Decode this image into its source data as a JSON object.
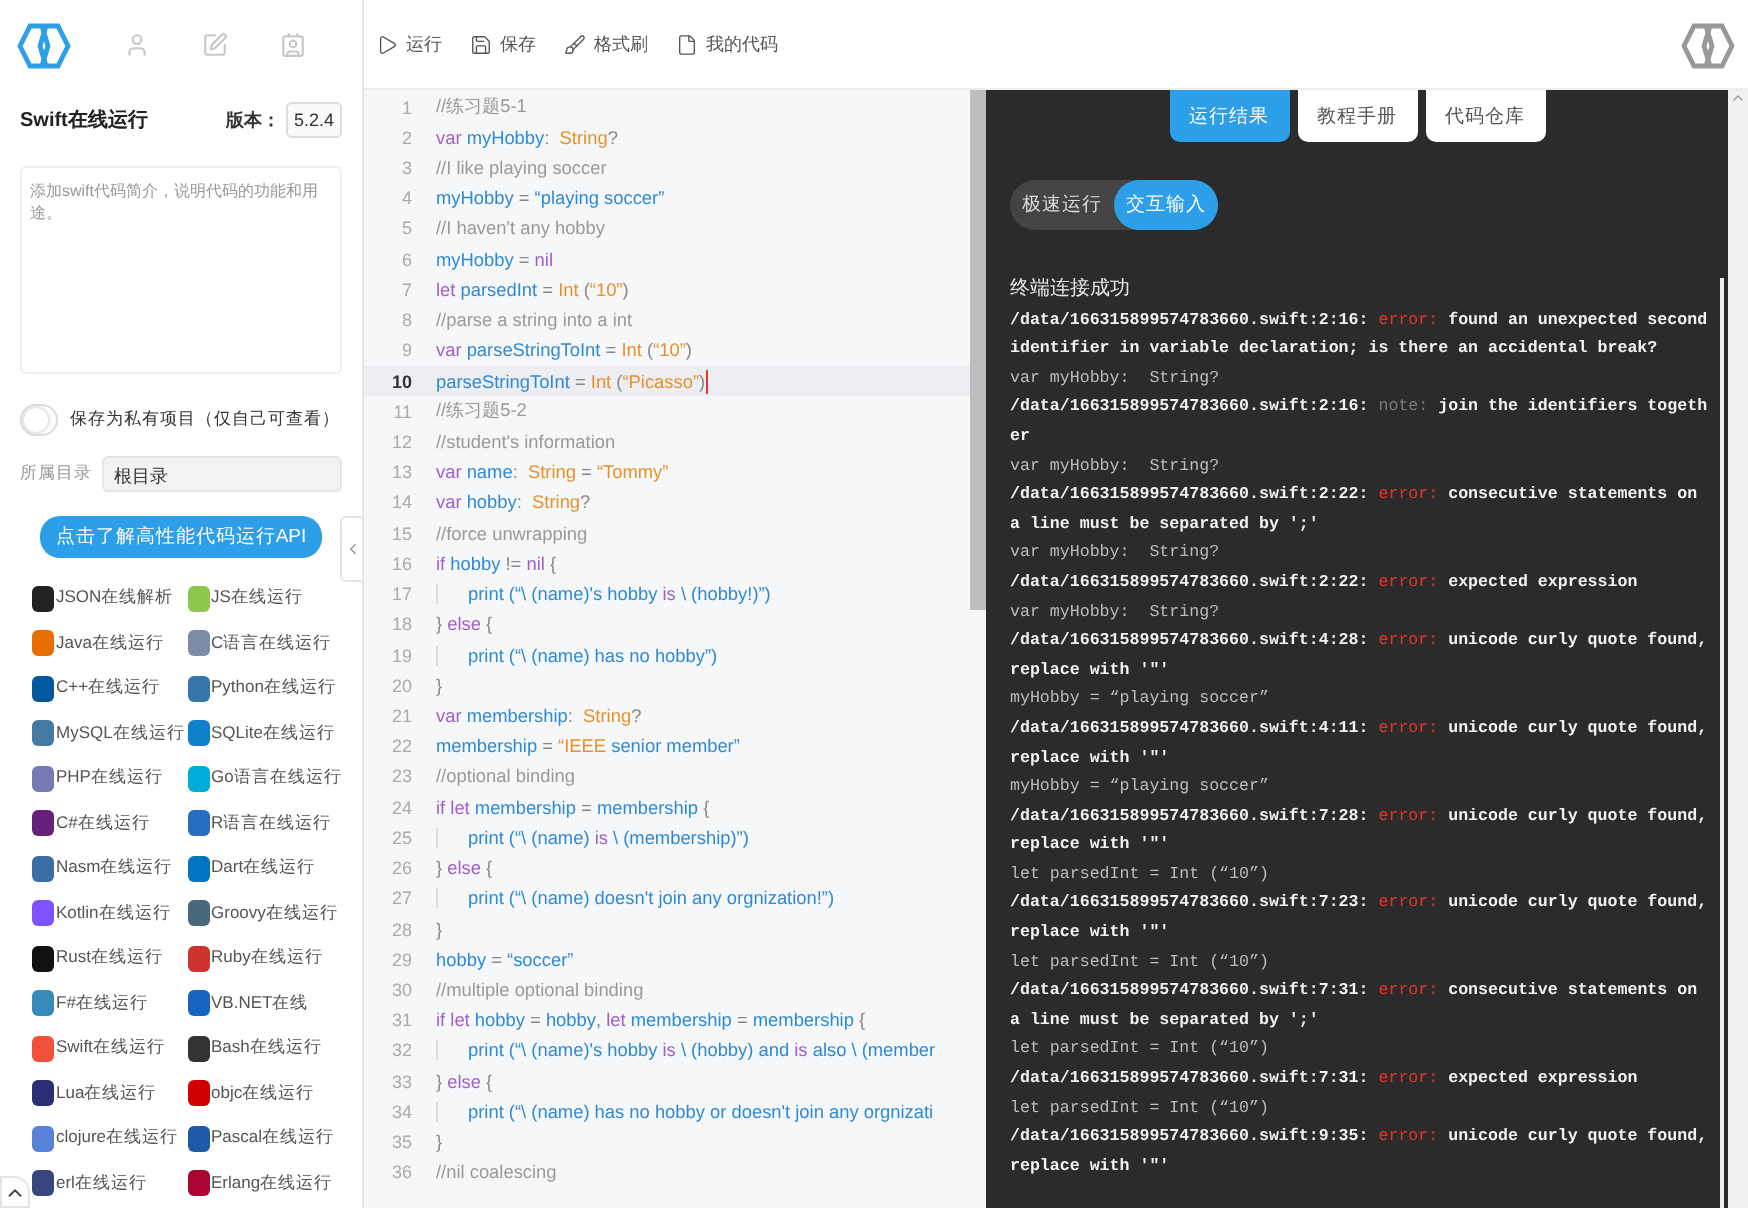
{
  "toolbar": {
    "buttons": [
      {
        "label": "运行",
        "kind": "run"
      },
      {
        "label": "保存",
        "kind": "save"
      },
      {
        "label": "格式刷",
        "kind": "format"
      },
      {
        "label": "我的代码",
        "kind": "file"
      }
    ]
  },
  "sidebar": {
    "title": "Swift在线运行",
    "version_label": "版本：",
    "version": "5.2.4",
    "description": {
      "placeholder": "添加swift代码简介，说明代码的功能和用途。"
    },
    "private_toggle": {
      "label": "保存为私有项目（仅自己可查看）",
      "on": false
    },
    "directory": {
      "label": "所属目录",
      "value": "根目录"
    },
    "api_button": "点击了解高性能代码运行API",
    "languages": [
      {
        "name": "JSON在线解析",
        "color": "#222222"
      },
      {
        "name": "JS在线运行",
        "color": "#8cc84b"
      },
      {
        "name": "Java在线运行",
        "color": "#e76f00"
      },
      {
        "name": "C语言在线运行",
        "color": "#7a8ca6"
      },
      {
        "name": "C++在线运行",
        "color": "#00599c"
      },
      {
        "name": "Python在线运行",
        "color": "#3776ab"
      },
      {
        "name": "MySQL在线运行",
        "color": "#4479a1"
      },
      {
        "name": "SQLite在线运行",
        "color": "#0f80cc"
      },
      {
        "name": "PHP在线运行",
        "color": "#777bb3"
      },
      {
        "name": "Go语言在线运行",
        "color": "#00add8"
      },
      {
        "name": "C#在线运行",
        "color": "#68217a"
      },
      {
        "name": "R语言在线运行",
        "color": "#276dc3"
      },
      {
        "name": "Nasm在线运行",
        "color": "#3a6ea5"
      },
      {
        "name": "Dart在线运行",
        "color": "#0175c2"
      },
      {
        "name": "Kotlin在线运行",
        "color": "#7f52ff"
      },
      {
        "name": "Groovy在线运行",
        "color": "#4a687c"
      },
      {
        "name": "Rust在线运行",
        "color": "#111111"
      },
      {
        "name": "Ruby在线运行",
        "color": "#cc342d"
      },
      {
        "name": "F#在线运行",
        "color": "#378bba"
      },
      {
        "name": "VB.NET在线",
        "color": "#1565c0"
      },
      {
        "name": "Swift在线运行",
        "color": "#f05138"
      },
      {
        "name": "Bash在线运行",
        "color": "#333333"
      },
      {
        "name": "Lua在线运行",
        "color": "#2c2d72"
      },
      {
        "name": "objc在线运行",
        "color": "#d00000"
      },
      {
        "name": "clojure在线运行",
        "color": "#5881d8"
      },
      {
        "name": "Pascal在线运行",
        "color": "#1e5aa8"
      },
      {
        "name": "erl在线运行",
        "color": "#39457e"
      },
      {
        "name": "Erlang在线运行",
        "color": "#a90533"
      }
    ]
  },
  "editor": {
    "lines": [
      {
        "n": "1",
        "active": false,
        "indent": false,
        "tokens": [
          {
            "kind": "comment",
            "text": "//练习题5-1"
          }
        ]
      },
      {
        "n": "2",
        "active": false,
        "indent": false,
        "tokens": [
          {
            "kind": "keyword",
            "text": "var"
          },
          {
            "kind": "ident",
            "text": " myHobby"
          },
          {
            "kind": "punct",
            "text": ":  "
          },
          {
            "kind": "type",
            "text": "String"
          },
          {
            "kind": "punct",
            "text": "?"
          }
        ]
      },
      {
        "n": "3",
        "active": false,
        "indent": false,
        "tokens": [
          {
            "kind": "comment",
            "text": "//I like playing soccer"
          }
        ]
      },
      {
        "n": "4",
        "active": false,
        "indent": false,
        "tokens": [
          {
            "kind": "ident",
            "text": "myHobby"
          },
          {
            "kind": "punct",
            "text": " = "
          },
          {
            "kind": "ident",
            "text": "“playing soccer”"
          }
        ]
      },
      {
        "n": "5",
        "active": false,
        "indent": false,
        "tokens": [
          {
            "kind": "comment",
            "text": "//I haven't any hobby"
          }
        ]
      },
      {
        "n": "6",
        "active": false,
        "indent": false,
        "tokens": [
          {
            "kind": "ident",
            "text": "myHobby"
          },
          {
            "kind": "punct",
            "text": " = "
          },
          {
            "kind": "keyword",
            "text": "nil"
          }
        ]
      },
      {
        "n": "7",
        "active": false,
        "indent": false,
        "tokens": [
          {
            "kind": "keyword",
            "text": "let"
          },
          {
            "kind": "ident",
            "text": " parsedInt"
          },
          {
            "kind": "punct",
            "text": " = "
          },
          {
            "kind": "type",
            "text": "Int"
          },
          {
            "kind": "punct",
            "text": " ("
          },
          {
            "kind": "type",
            "text": "“10”"
          },
          {
            "kind": "punct",
            "text": ")"
          }
        ]
      },
      {
        "n": "8",
        "active": false,
        "indent": false,
        "tokens": [
          {
            "kind": "comment",
            "text": "//parse a string into a int"
          }
        ]
      },
      {
        "n": "9",
        "active": false,
        "indent": false,
        "tokens": [
          {
            "kind": "keyword",
            "text": "var"
          },
          {
            "kind": "ident",
            "text": " parseStringToInt"
          },
          {
            "kind": "punct",
            "text": " = "
          },
          {
            "kind": "type",
            "text": "Int"
          },
          {
            "kind": "punct",
            "text": " ("
          },
          {
            "kind": "type",
            "text": "“10”"
          },
          {
            "kind": "punct",
            "text": ")"
          }
        ]
      },
      {
        "n": "10",
        "active": true,
        "indent": false,
        "tokens": [
          {
            "kind": "ident",
            "text": "parseStringToInt"
          },
          {
            "kind": "punct",
            "text": " = "
          },
          {
            "kind": "type",
            "text": "Int"
          },
          {
            "kind": "punct",
            "text": " ("
          },
          {
            "kind": "type",
            "text": "“Picasso”"
          },
          {
            "kind": "punct",
            "text": ")"
          }
        ]
      },
      {
        "n": "11",
        "active": false,
        "indent": false,
        "tokens": [
          {
            "kind": "comment",
            "text": "//练习题5-2"
          }
        ]
      },
      {
        "n": "12",
        "active": false,
        "indent": false,
        "tokens": [
          {
            "kind": "comment",
            "text": "//student's information"
          }
        ]
      },
      {
        "n": "13",
        "active": false,
        "indent": false,
        "tokens": [
          {
            "kind": "keyword",
            "text": "var"
          },
          {
            "kind": "ident",
            "text": " name"
          },
          {
            "kind": "punct",
            "text": ":  "
          },
          {
            "kind": "type",
            "text": "String"
          },
          {
            "kind": "punct",
            "text": " = "
          },
          {
            "kind": "type",
            "text": "“Tommy”"
          }
        ]
      },
      {
        "n": "14",
        "active": false,
        "indent": false,
        "tokens": [
          {
            "kind": "keyword",
            "text": "var"
          },
          {
            "kind": "ident",
            "text": " hobby"
          },
          {
            "kind": "punct",
            "text": ":  "
          },
          {
            "kind": "type",
            "text": "String"
          },
          {
            "kind": "punct",
            "text": "?"
          }
        ]
      },
      {
        "n": "15",
        "active": false,
        "indent": false,
        "tokens": [
          {
            "kind": "comment",
            "text": "//force unwrapping"
          }
        ]
      },
      {
        "n": "16",
        "active": false,
        "indent": false,
        "tokens": [
          {
            "kind": "keyword",
            "text": "if"
          },
          {
            "kind": "ident",
            "text": " hobby"
          },
          {
            "kind": "punct",
            "text": " != "
          },
          {
            "kind": "keyword",
            "text": "nil"
          },
          {
            "kind": "punct",
            "text": " {"
          }
        ]
      },
      {
        "n": "17",
        "active": false,
        "indent": true,
        "tokens": [
          {
            "kind": "ident",
            "text": "print (“\\ (name)'s hobby "
          },
          {
            "kind": "keyword",
            "text": "is"
          },
          {
            "kind": "ident",
            "text": " \\ (hobby!)”)"
          }
        ]
      },
      {
        "n": "18",
        "active": false,
        "indent": false,
        "tokens": [
          {
            "kind": "punct",
            "text": "} "
          },
          {
            "kind": "keyword",
            "text": "else"
          },
          {
            "kind": "punct",
            "text": " {"
          }
        ]
      },
      {
        "n": "19",
        "active": false,
        "indent": true,
        "tokens": [
          {
            "kind": "ident",
            "text": "print (“\\ (name) has no hobby”)"
          }
        ]
      },
      {
        "n": "20",
        "active": false,
        "indent": false,
        "tokens": [
          {
            "kind": "punct",
            "text": "}"
          }
        ]
      },
      {
        "n": "21",
        "active": false,
        "indent": false,
        "tokens": [
          {
            "kind": "keyword",
            "text": "var"
          },
          {
            "kind": "ident",
            "text": " membership"
          },
          {
            "kind": "punct",
            "text": ":  "
          },
          {
            "kind": "type",
            "text": "String"
          },
          {
            "kind": "punct",
            "text": "?"
          }
        ]
      },
      {
        "n": "22",
        "active": false,
        "indent": false,
        "tokens": [
          {
            "kind": "ident",
            "text": "membership"
          },
          {
            "kind": "punct",
            "text": " = "
          },
          {
            "kind": "type",
            "text": "“IEEE"
          },
          {
            "kind": "ident",
            "text": " senior member”"
          }
        ]
      },
      {
        "n": "23",
        "active": false,
        "indent": false,
        "tokens": [
          {
            "kind": "comment",
            "text": "//optional binding"
          }
        ]
      },
      {
        "n": "24",
        "active": false,
        "indent": false,
        "tokens": [
          {
            "kind": "keyword",
            "text": "if let"
          },
          {
            "kind": "ident",
            "text": " membership"
          },
          {
            "kind": "punct",
            "text": " = "
          },
          {
            "kind": "ident",
            "text": "membership"
          },
          {
            "kind": "punct",
            "text": " {"
          }
        ]
      },
      {
        "n": "25",
        "active": false,
        "indent": true,
        "tokens": [
          {
            "kind": "ident",
            "text": "print (“\\ (name) "
          },
          {
            "kind": "keyword",
            "text": "is"
          },
          {
            "kind": "ident",
            "text": " \\ (membership)”)"
          }
        ]
      },
      {
        "n": "26",
        "active": false,
        "indent": false,
        "tokens": [
          {
            "kind": "punct",
            "text": "} "
          },
          {
            "kind": "keyword",
            "text": "else"
          },
          {
            "kind": "punct",
            "text": " {"
          }
        ]
      },
      {
        "n": "27",
        "active": false,
        "indent": true,
        "tokens": [
          {
            "kind": "ident",
            "text": "print (“\\ (name) doesn't join any orgnization!”)"
          }
        ]
      },
      {
        "n": "28",
        "active": false,
        "indent": false,
        "tokens": [
          {
            "kind": "punct",
            "text": "}"
          }
        ]
      },
      {
        "n": "29",
        "active": false,
        "indent": false,
        "tokens": [
          {
            "kind": "ident",
            "text": "hobby"
          },
          {
            "kind": "punct",
            "text": " = "
          },
          {
            "kind": "ident",
            "text": "“soccer”"
          }
        ]
      },
      {
        "n": "30",
        "active": false,
        "indent": false,
        "tokens": [
          {
            "kind": "comment",
            "text": "//multiple optional binding"
          }
        ]
      },
      {
        "n": "31",
        "active": false,
        "indent": false,
        "tokens": [
          {
            "kind": "keyword",
            "text": "if let"
          },
          {
            "kind": "ident",
            "text": " hobby"
          },
          {
            "kind": "punct",
            "text": " = "
          },
          {
            "kind": "ident",
            "text": "hobby"
          },
          {
            "kind": "punct",
            "text": ", "
          },
          {
            "kind": "keyword",
            "text": "let"
          },
          {
            "kind": "ident",
            "text": " membership"
          },
          {
            "kind": "punct",
            "text": " = "
          },
          {
            "kind": "ident",
            "text": "membership"
          },
          {
            "kind": "punct",
            "text": " {"
          }
        ]
      },
      {
        "n": "32",
        "active": false,
        "indent": true,
        "tokens": [
          {
            "kind": "ident",
            "text": "print (“\\ (name)'s hobby "
          },
          {
            "kind": "keyword",
            "text": "is"
          },
          {
            "kind": "ident",
            "text": " \\ (hobby) and "
          },
          {
            "kind": "keyword",
            "text": "is"
          },
          {
            "kind": "ident",
            "text": " also \\ (member"
          }
        ]
      },
      {
        "n": "33",
        "active": false,
        "indent": false,
        "tokens": [
          {
            "kind": "punct",
            "text": "} "
          },
          {
            "kind": "keyword",
            "text": "else"
          },
          {
            "kind": "punct",
            "text": " {"
          }
        ]
      },
      {
        "n": "34",
        "active": false,
        "indent": true,
        "tokens": [
          {
            "kind": "ident",
            "text": "print (“\\ (name) has no hobby or doesn't join any orgnizati"
          }
        ]
      },
      {
        "n": "35",
        "active": false,
        "indent": false,
        "tokens": [
          {
            "kind": "punct",
            "text": "}"
          }
        ]
      },
      {
        "n": "36",
        "active": false,
        "indent": false,
        "tokens": [
          {
            "kind": "comment",
            "text": "//nil coalescing"
          }
        ]
      }
    ]
  },
  "output": {
    "tabs": [
      {
        "label": "运行结果",
        "selected": true
      },
      {
        "label": "教程手册",
        "selected": false
      },
      {
        "label": "代码仓库",
        "selected": false
      }
    ],
    "modes": [
      {
        "label": "极速运行",
        "selected": false
      },
      {
        "label": "交互输入",
        "selected": true
      }
    ],
    "lines": [
      {
        "kind": "info",
        "text": "终端连接成功"
      },
      {
        "kind": "diag",
        "path": "/data/166315899574783660.swift:2:16:",
        "tag": {
          "kind": "error",
          "text": "error:"
        },
        "message": "found an unexpected second identifier in variable declaration; is there an accidental break?"
      },
      {
        "kind": "echo",
        "text": "var myHobby:  String?"
      },
      {
        "kind": "diag",
        "path": "/data/166315899574783660.swift:2:16:",
        "tag": {
          "kind": "note",
          "text": "note:"
        },
        "message": "join the identifiers together"
      },
      {
        "kind": "echo",
        "text": "var myHobby:  String?"
      },
      {
        "kind": "diag",
        "path": "/data/166315899574783660.swift:2:22:",
        "tag": {
          "kind": "error",
          "text": "error:"
        },
        "message": "consecutive statements on a line must be separated by ';'"
      },
      {
        "kind": "echo",
        "text": "var myHobby:  String?"
      },
      {
        "kind": "diag",
        "path": "/data/166315899574783660.swift:2:22:",
        "tag": {
          "kind": "error",
          "text": "error:"
        },
        "message": "expected expression"
      },
      {
        "kind": "echo",
        "text": "var myHobby:  String?"
      },
      {
        "kind": "diag",
        "path": "/data/166315899574783660.swift:4:28:",
        "tag": {
          "kind": "error",
          "text": "error:"
        },
        "message": "unicode curly quote found, replace with '\"'"
      },
      {
        "kind": "echo",
        "text": "myHobby = “playing soccer”"
      },
      {
        "kind": "diag",
        "path": "/data/166315899574783660.swift:4:11:",
        "tag": {
          "kind": "error",
          "text": "error:"
        },
        "message": "unicode curly quote found, replace with '\"'"
      },
      {
        "kind": "echo",
        "text": "myHobby = “playing soccer”"
      },
      {
        "kind": "diag",
        "path": "/data/166315899574783660.swift:7:28:",
        "tag": {
          "kind": "error",
          "text": "error:"
        },
        "message": "unicode curly quote found, replace with '\"'"
      },
      {
        "kind": "echo",
        "text": "let parsedInt = Int (“10”)"
      },
      {
        "kind": "diag",
        "path": "/data/166315899574783660.swift:7:23:",
        "tag": {
          "kind": "error",
          "text": "error:"
        },
        "message": "unicode curly quote found, replace with '\"'"
      },
      {
        "kind": "echo",
        "text": "let parsedInt = Int (“10”)"
      },
      {
        "kind": "diag",
        "path": "/data/166315899574783660.swift:7:31:",
        "tag": {
          "kind": "error",
          "text": "error:"
        },
        "message": "consecutive statements on a line must be separated by ';'"
      },
      {
        "kind": "echo",
        "text": "let parsedInt = Int (“10”)"
      },
      {
        "kind": "diag",
        "path": "/data/166315899574783660.swift:7:31:",
        "tag": {
          "kind": "error",
          "text": "error:"
        },
        "message": "expected expression"
      },
      {
        "kind": "echo",
        "text": "let parsedInt = Int (“10”)"
      },
      {
        "kind": "diag",
        "path": "/data/166315899574783660.swift:9:35:",
        "tag": {
          "kind": "error",
          "text": "error:"
        },
        "message": "unicode curly quote found, replace with '\"'"
      }
    ]
  }
}
